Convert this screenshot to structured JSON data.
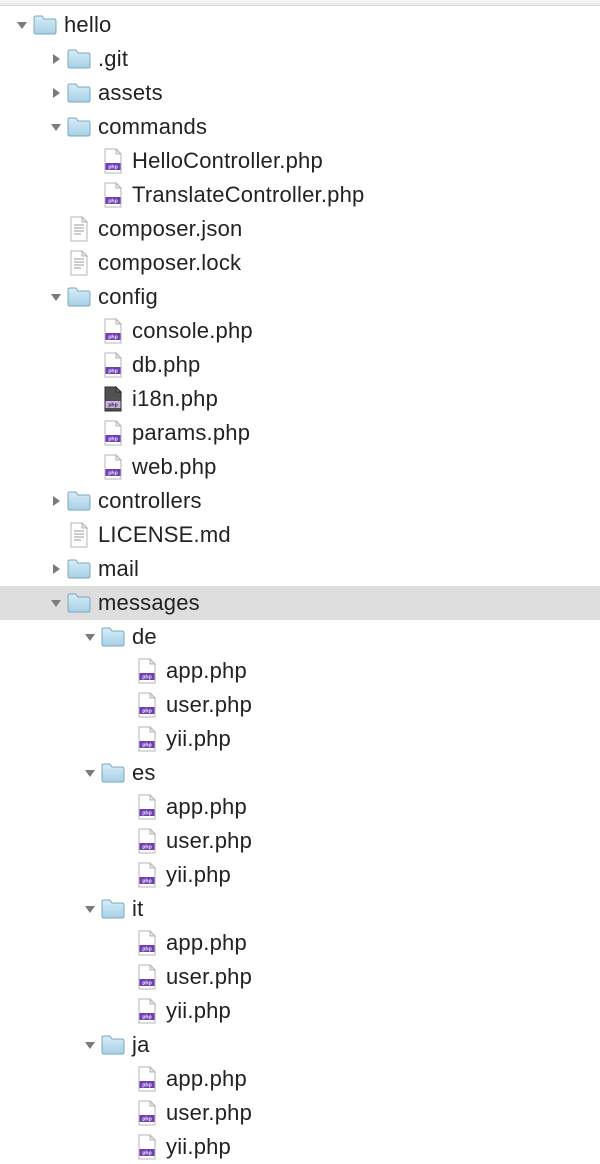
{
  "tree": [
    {
      "depth": 0,
      "kind": "folder",
      "state": "open",
      "label": "hello",
      "name": "folder-hello"
    },
    {
      "depth": 1,
      "kind": "folder",
      "state": "closed",
      "label": ".git",
      "name": "folder-git"
    },
    {
      "depth": 1,
      "kind": "folder",
      "state": "closed",
      "label": "assets",
      "name": "folder-assets"
    },
    {
      "depth": 1,
      "kind": "folder",
      "state": "open",
      "label": "commands",
      "name": "folder-commands"
    },
    {
      "depth": 2,
      "kind": "php",
      "state": "none",
      "label": "HelloController.php",
      "name": "file-hellocontroller-php"
    },
    {
      "depth": 2,
      "kind": "php",
      "state": "none",
      "label": "TranslateController.php",
      "name": "file-translatecontroller-php"
    },
    {
      "depth": 1,
      "kind": "text",
      "state": "none",
      "label": "composer.json",
      "name": "file-composer-json"
    },
    {
      "depth": 1,
      "kind": "text",
      "state": "none",
      "label": "composer.lock",
      "name": "file-composer-lock"
    },
    {
      "depth": 1,
      "kind": "folder",
      "state": "open",
      "label": "config",
      "name": "folder-config"
    },
    {
      "depth": 2,
      "kind": "php",
      "state": "none",
      "label": "console.php",
      "name": "file-console-php"
    },
    {
      "depth": 2,
      "kind": "php",
      "state": "none",
      "label": "db.php",
      "name": "file-db-php"
    },
    {
      "depth": 2,
      "kind": "php-dk",
      "state": "none",
      "label": "i18n.php",
      "name": "file-i18n-php"
    },
    {
      "depth": 2,
      "kind": "php",
      "state": "none",
      "label": "params.php",
      "name": "file-params-php"
    },
    {
      "depth": 2,
      "kind": "php",
      "state": "none",
      "label": "web.php",
      "name": "file-web-php"
    },
    {
      "depth": 1,
      "kind": "folder",
      "state": "closed",
      "label": "controllers",
      "name": "folder-controllers"
    },
    {
      "depth": 1,
      "kind": "text",
      "state": "none",
      "label": "LICENSE.md",
      "name": "file-license-md"
    },
    {
      "depth": 1,
      "kind": "folder",
      "state": "closed",
      "label": "mail",
      "name": "folder-mail"
    },
    {
      "depth": 1,
      "kind": "folder",
      "state": "open",
      "label": "messages",
      "name": "folder-messages",
      "selected": true
    },
    {
      "depth": 2,
      "kind": "folder",
      "state": "open",
      "label": "de",
      "name": "folder-de"
    },
    {
      "depth": 3,
      "kind": "php",
      "state": "none",
      "label": "app.php",
      "name": "file-de-app-php"
    },
    {
      "depth": 3,
      "kind": "php",
      "state": "none",
      "label": "user.php",
      "name": "file-de-user-php"
    },
    {
      "depth": 3,
      "kind": "php",
      "state": "none",
      "label": "yii.php",
      "name": "file-de-yii-php"
    },
    {
      "depth": 2,
      "kind": "folder",
      "state": "open",
      "label": "es",
      "name": "folder-es"
    },
    {
      "depth": 3,
      "kind": "php",
      "state": "none",
      "label": "app.php",
      "name": "file-es-app-php"
    },
    {
      "depth": 3,
      "kind": "php",
      "state": "none",
      "label": "user.php",
      "name": "file-es-user-php"
    },
    {
      "depth": 3,
      "kind": "php",
      "state": "none",
      "label": "yii.php",
      "name": "file-es-yii-php"
    },
    {
      "depth": 2,
      "kind": "folder",
      "state": "open",
      "label": "it",
      "name": "folder-it"
    },
    {
      "depth": 3,
      "kind": "php",
      "state": "none",
      "label": "app.php",
      "name": "file-it-app-php"
    },
    {
      "depth": 3,
      "kind": "php",
      "state": "none",
      "label": "user.php",
      "name": "file-it-user-php"
    },
    {
      "depth": 3,
      "kind": "php",
      "state": "none",
      "label": "yii.php",
      "name": "file-it-yii-php"
    },
    {
      "depth": 2,
      "kind": "folder",
      "state": "open",
      "label": "ja",
      "name": "folder-ja"
    },
    {
      "depth": 3,
      "kind": "php",
      "state": "none",
      "label": "app.php",
      "name": "file-ja-app-php"
    },
    {
      "depth": 3,
      "kind": "php",
      "state": "none",
      "label": "user.php",
      "name": "file-ja-user-php"
    },
    {
      "depth": 3,
      "kind": "php",
      "state": "none",
      "label": "yii.php",
      "name": "file-ja-yii-php"
    }
  ],
  "indent": {
    "base": 14,
    "step": 34
  }
}
